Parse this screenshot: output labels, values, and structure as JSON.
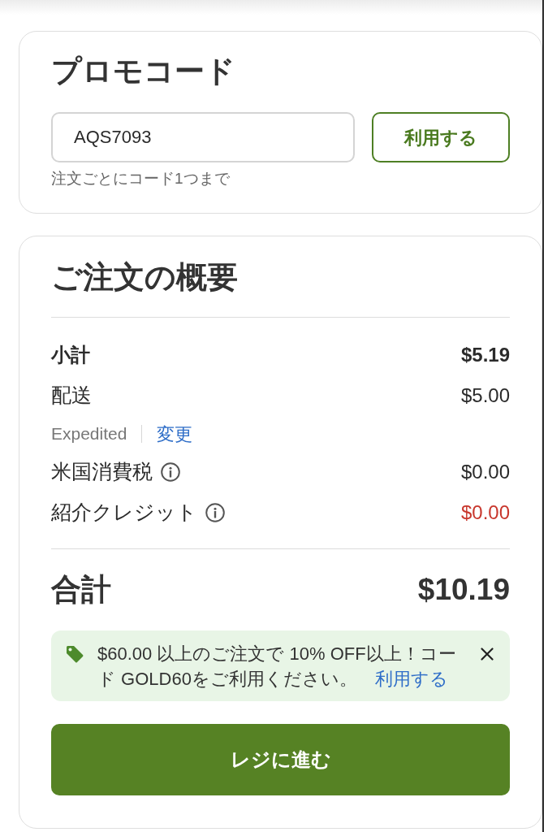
{
  "promo_code": {
    "title": "プロモコード",
    "input": {
      "value": "AQS7093"
    },
    "apply_button": "利用する",
    "hint": "注文ごとにコード1つまで"
  },
  "order_summary": {
    "title": "ご注文の概要",
    "rows": [
      {
        "kind": "subtotal",
        "label": "小計",
        "amount": "$5.19"
      },
      {
        "kind": "line",
        "label": "配送",
        "amount": "$5.00"
      },
      {
        "kind": "shipping_method",
        "method": "Expedited",
        "link": "変更"
      },
      {
        "kind": "line",
        "label": "米国消費税",
        "info": true,
        "amount": "$0.00"
      },
      {
        "kind": "credit",
        "label": "紹介クレジット",
        "info": true,
        "amount": "$0.00"
      }
    ],
    "total": {
      "label": "合計",
      "amount": "$10.19"
    },
    "promo_banner": {
      "message": "$60.00 以上のご注文で 10% OFF以上！コード GOLD60をご利用ください。",
      "link": "利用する"
    },
    "checkout_button": "レジに進む"
  }
}
